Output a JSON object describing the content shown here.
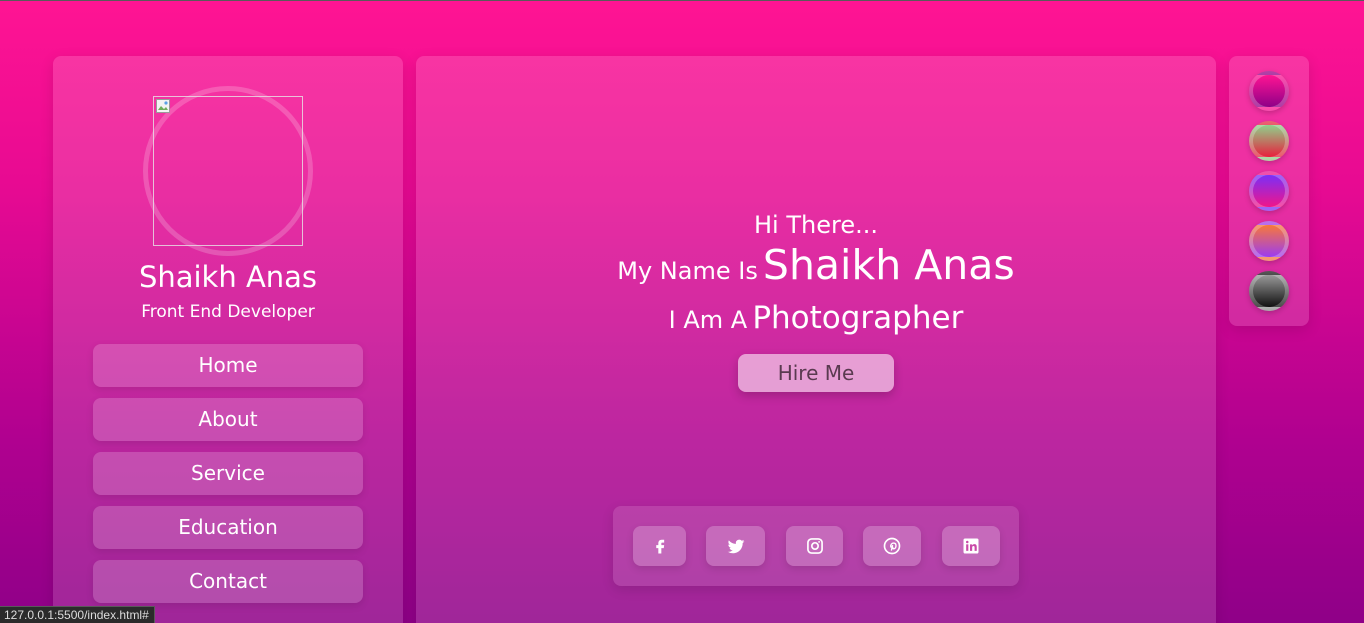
{
  "profile": {
    "name": "Shaikh Anas",
    "role": "Front End Developer"
  },
  "nav": {
    "items": [
      {
        "label": "Home"
      },
      {
        "label": "About"
      },
      {
        "label": "Service"
      },
      {
        "label": "Education"
      },
      {
        "label": "Contact"
      }
    ]
  },
  "hero": {
    "greeting": "Hi There...",
    "name_prefix": "My Name Is",
    "name": "Shaikh Anas",
    "role_prefix": "I Am A",
    "role": "Photographer",
    "hire_label": "Hire Me"
  },
  "social": {
    "icons": [
      "facebook-icon",
      "twitter-icon",
      "instagram-icon",
      "pinterest-icon",
      "linkedin-icon"
    ]
  },
  "themes": {
    "swatches": [
      {
        "name": "magenta-purple",
        "colors": [
          "#ff1493",
          "#8f0088"
        ]
      },
      {
        "name": "green-red",
        "colors": [
          "#8fd18b",
          "#e8203c"
        ]
      },
      {
        "name": "purple-pink",
        "colors": [
          "#7b2ff7",
          "#f0158a"
        ]
      },
      {
        "name": "orange-purple",
        "colors": [
          "#f7783a",
          "#9c3cf0"
        ]
      },
      {
        "name": "gray-black",
        "colors": [
          "#9a9a9a",
          "#111111"
        ]
      }
    ]
  },
  "status": {
    "url": "127.0.0.1:5500/index.html#"
  }
}
